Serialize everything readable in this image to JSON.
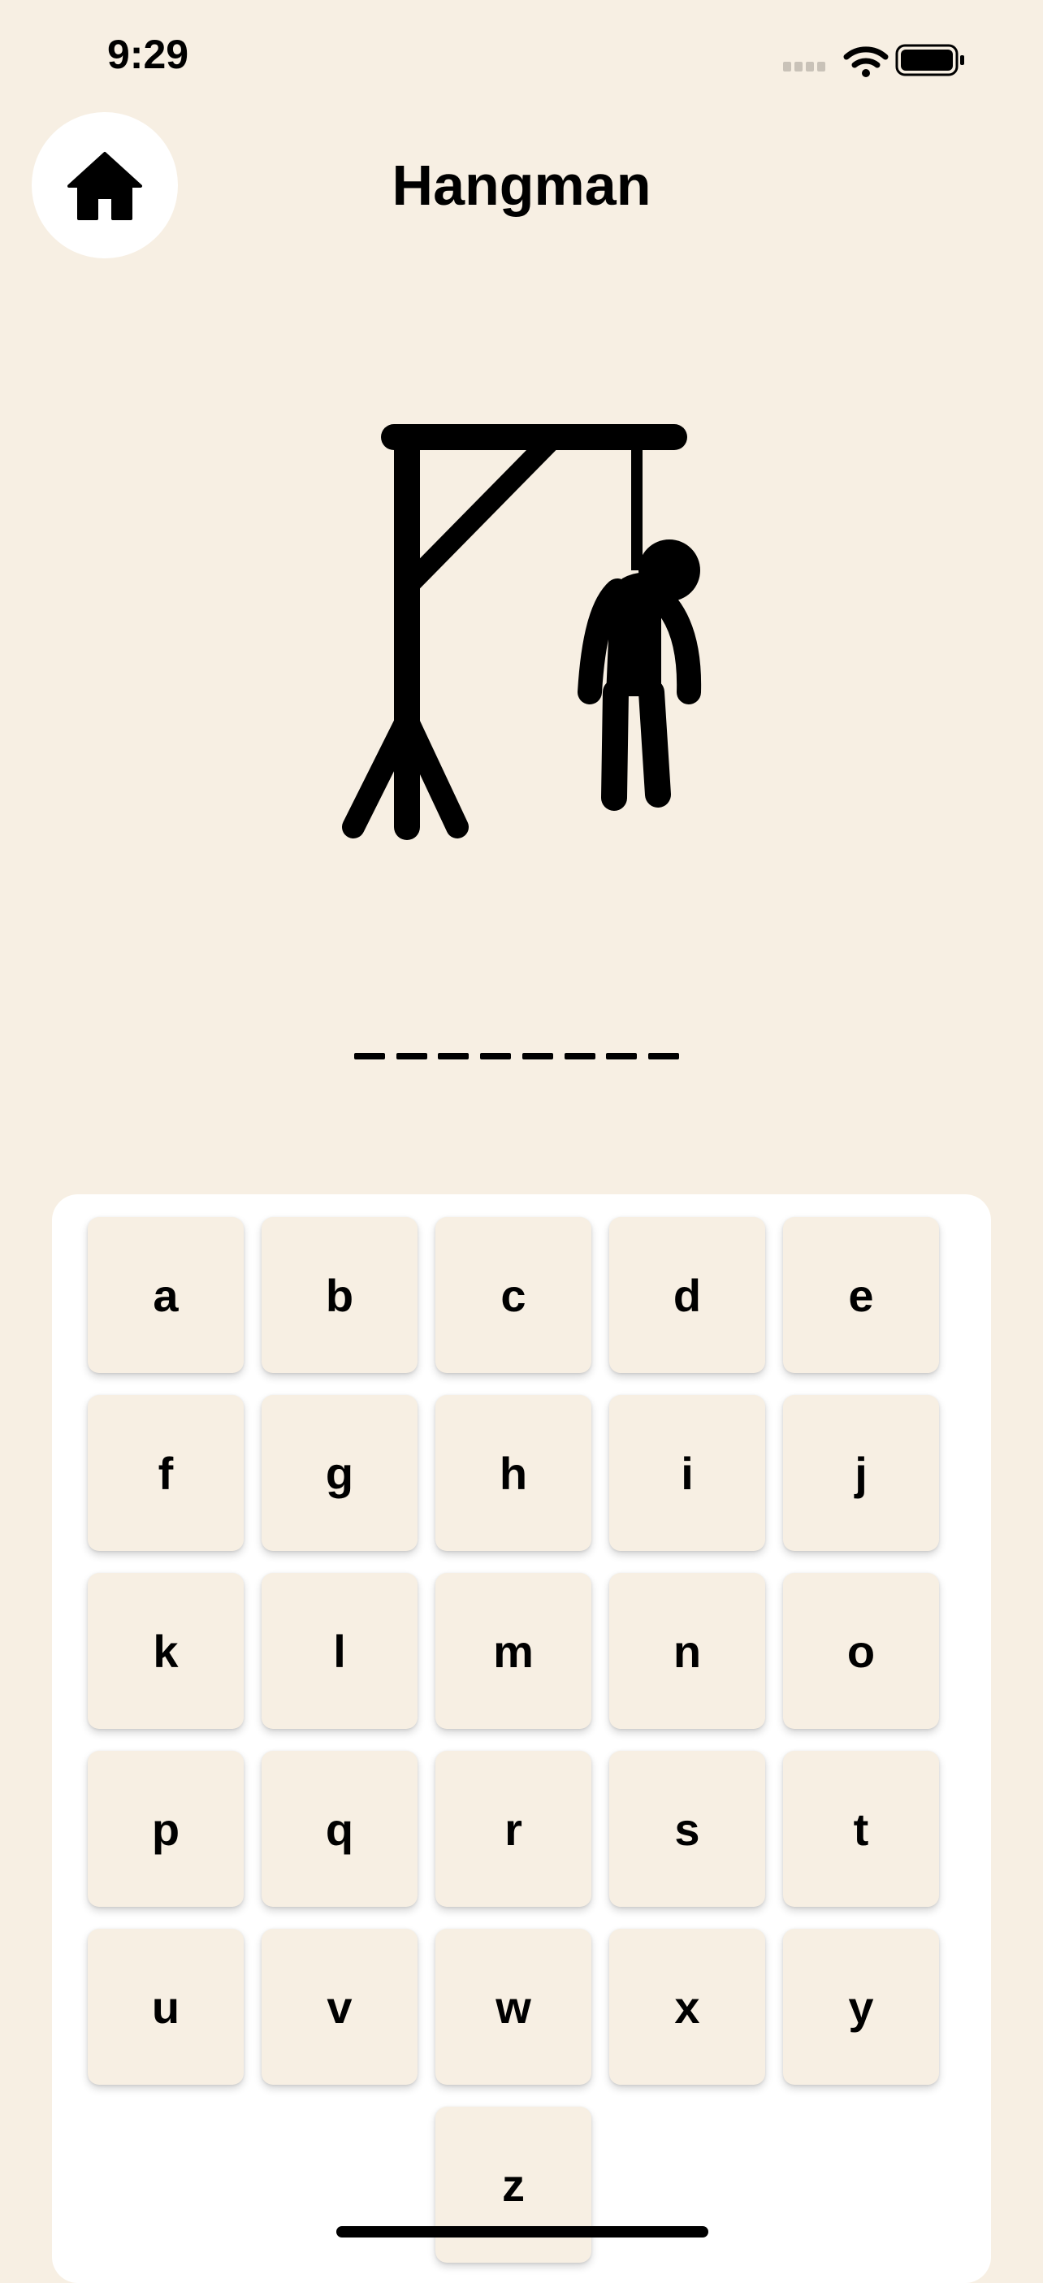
{
  "status_bar": {
    "time": "9:29"
  },
  "header": {
    "title": "Hangman",
    "home_icon": "house-icon"
  },
  "word": {
    "blanks": 8,
    "revealed": [
      "",
      "",
      "",
      "",
      "",
      "",
      "",
      ""
    ]
  },
  "keyboard": {
    "keys": [
      "a",
      "b",
      "c",
      "d",
      "e",
      "f",
      "g",
      "h",
      "i",
      "j",
      "k",
      "l",
      "m",
      "n",
      "o",
      "p",
      "q",
      "r",
      "s",
      "t",
      "u",
      "v",
      "w",
      "x",
      "y",
      "z"
    ]
  },
  "colors": {
    "background": "#f7efe3",
    "key_bg": "#f7efe3",
    "panel": "#ffffff",
    "ink": "#000000"
  }
}
